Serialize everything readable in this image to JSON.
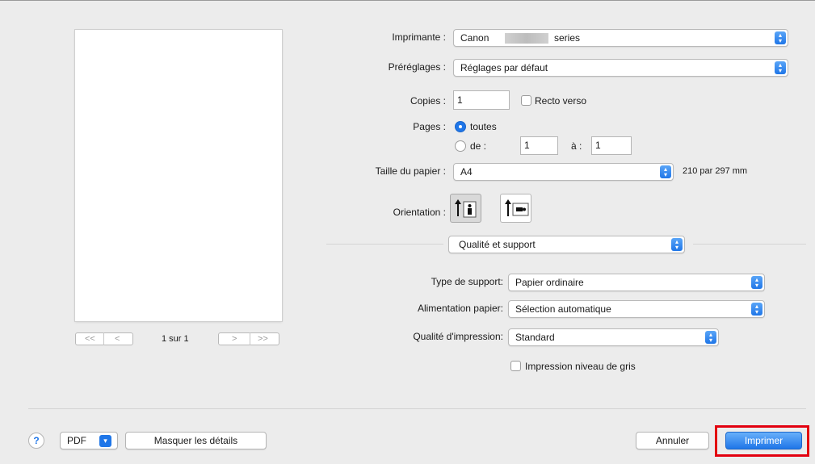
{
  "preview": {
    "page_indicator": "1 sur 1",
    "first_label": "<<",
    "prev_label": "<",
    "next_label": ">",
    "last_label": ">>"
  },
  "printer": {
    "label": "Imprimante :",
    "value_prefix": "Canon",
    "value_suffix": "series"
  },
  "presets": {
    "label": "Préréglages :",
    "value": "Réglages par défaut"
  },
  "copies": {
    "label": "Copies :",
    "value": "1",
    "duplex_label": "Recto verso"
  },
  "pages": {
    "label": "Pages :",
    "all_label": "toutes",
    "from_label": "de :",
    "from_value": "1",
    "to_label": "à :",
    "to_value": "1"
  },
  "paper_size": {
    "label": "Taille du papier :",
    "value": "A4",
    "dimensions": "210 par 297 mm"
  },
  "orientation": {
    "label": "Orientation :"
  },
  "section_popup": {
    "value": "Qualité et support"
  },
  "media_type": {
    "label": "Type de support:",
    "value": "Papier ordinaire"
  },
  "paper_source": {
    "label": "Alimentation papier:",
    "value": "Sélection automatique"
  },
  "print_quality": {
    "label": "Qualité d'impression:",
    "value": "Standard"
  },
  "grayscale": {
    "label": "Impression niveau de gris"
  },
  "footer": {
    "help_label": "?",
    "pdf_label": "PDF",
    "hide_details_label": "Masquer les détails",
    "cancel_label": "Annuler",
    "print_label": "Imprimer"
  },
  "colors": {
    "accent": "#1f76e8",
    "highlight_border": "#e3000f"
  }
}
